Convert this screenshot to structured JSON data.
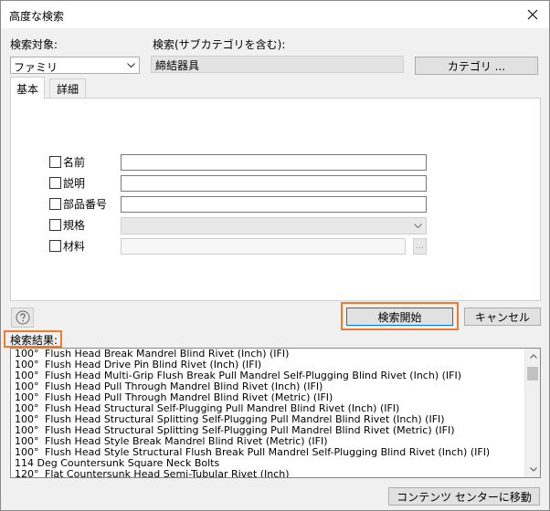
{
  "window": {
    "title": "高度な検索"
  },
  "search_target": {
    "label": "検索対象:",
    "value": "ファミリ"
  },
  "search_category": {
    "label": "検索(サブカテゴリを含む):",
    "value": "締結器具",
    "category_button": "カテゴリ ..."
  },
  "tabs": [
    {
      "label": "基本",
      "active": true
    },
    {
      "label": "詳細",
      "active": false
    }
  ],
  "fields": [
    {
      "label": "名前",
      "value": ""
    },
    {
      "label": "説明",
      "value": ""
    },
    {
      "label": "部品番号",
      "value": ""
    },
    {
      "label": "規格",
      "value": ""
    },
    {
      "label": "材料",
      "value": "",
      "browse": "..."
    }
  ],
  "actions": {
    "search_start": "検索開始",
    "cancel": "キャンセル",
    "move_to_content_center": "コンテンツ センターに移動"
  },
  "results": {
    "label": "検索結果:",
    "rows": [
      {
        "c1": "100°",
        "c2": "Flush Head Break Mandrel Blind Rivet (Inch) (IFI)"
      },
      {
        "c1": "100°",
        "c2": "Flush Head Drive Pin Blind Rivet (Inch) (IFI)"
      },
      {
        "c1": "100°",
        "c2": "Flush Head Multi-Grip Flush Break Pull Mandrel Self-Plugging Blind Rivet (Inch) (IFI)"
      },
      {
        "c1": "100°",
        "c2": "Flush Head Pull Through Mandrel Blind Rivet (Inch) (IFI)"
      },
      {
        "c1": "100°",
        "c2": "Flush Head Pull Through Mandrel Blind Rivet (Metric) (IFI)"
      },
      {
        "c1": "100°",
        "c2": "Flush Head Structural Self-Plugging Pull Mandrel Blind Rivet (Inch) (IFI)"
      },
      {
        "c1": "100°",
        "c2": "Flush Head Structural Splitting Self-Plugging Pull Mandrel Blind Rivet (Inch) (IFI)"
      },
      {
        "c1": "100°",
        "c2": "Flush Head Structural Splitting Self-Plugging Pull Mandrel Blind Rivet (Metric) (IFI)"
      },
      {
        "c1": "100°",
        "c2": "Flush Head Style Break Mandrel Blind Rivet (Metric) (IFI)"
      },
      {
        "c1": "100°",
        "c2": "Flush Head Style Structural Flush Break Pull Mandrel Self-Plugging Blind Rivet (Inch) (IFI)"
      },
      {
        "c1": "114 Deg Countersunk Square Neck Bolts",
        "c2": ""
      },
      {
        "c1": "120°",
        "c2": "Flat Countersunk Head Semi-Tubular Rivet (Inch)"
      }
    ]
  },
  "icons": {
    "close": "close-icon",
    "help": "help-icon",
    "dropdown": "chevron-down-icon",
    "scroll_up": "scroll-up-icon",
    "scroll_down": "scroll-down-icon"
  },
  "colors": {
    "highlight": "#f07b2c",
    "window_bg": "#f0f0f0"
  }
}
